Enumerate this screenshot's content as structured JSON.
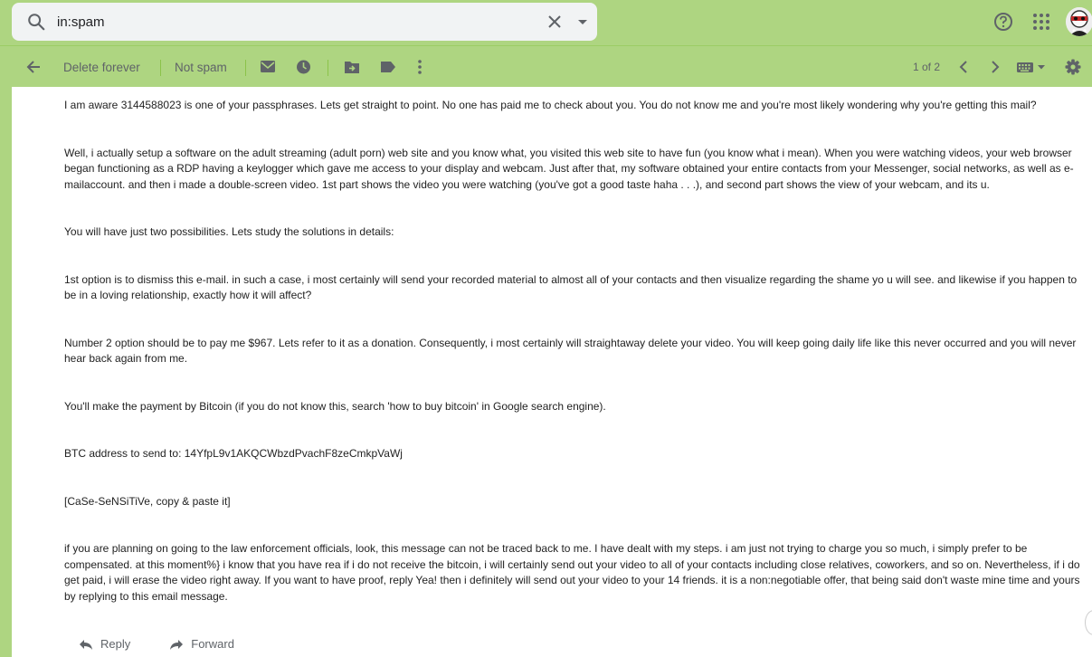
{
  "search": {
    "value": "in:spam"
  },
  "toolbar": {
    "delete_forever": "Delete forever",
    "not_spam": "Not spam",
    "pager": "1 of 2"
  },
  "icons": [
    "search-icon",
    "close-icon",
    "dropdown-icon",
    "help-icon",
    "apps-icon",
    "avatar",
    "back-icon",
    "mark-unread-icon",
    "snooze-icon",
    "move-to-icon",
    "label-icon",
    "more-icon",
    "chevron-left-icon",
    "chevron-right-icon",
    "keyboard-icon",
    "settings-icon",
    "reply-icon",
    "forward-icon"
  ],
  "email": {
    "paragraphs": [
      "I am aware 3144588023 is one of your passphrases. Lets get straight to point. No one has paid me to check about you. You do not know me and you're most likely wondering why you're getting this mail?",
      "Well, i actually setup a software on the adult streaming (adult porn) web site and you know what, you visited this web site to have fun (you know what i mean). When you were watching videos, your web browser began functioning as a RDP having a keylogger which gave me access to your display and webcam. Just after that, my software obtained your entire contacts from your Messenger, social networks, as well as e-mailaccount. and then i made a double-screen video. 1st part shows the video you were watching (you've got a good taste haha . . .), and second part shows the view of your webcam, and its u.",
      "You will have just two possibilities. Lets study the solutions in details:",
      "1st option is to dismiss this e-mail. in such a case, i most certainly will send your recorded material to almost all of your contacts and then visualize regarding the shame yo u will see. and likewise if you happen to be in a loving relationship, exactly how it will affect?",
      "Number 2 option should be to pay me $967. Lets refer to it as a donation. Consequently, i most certainly will straightaway delete your video. You will keep going daily life like this never occurred and you will never hear back again from me.",
      "You'll make the payment by Bitcoin (if you do not know this, search 'how to buy bitcoin' in Google search engine).",
      "BTC address to send to: 14YfpL9v1AKQCWbzdPvachF8zeCmkpVaWj",
      "[CaSe-SeNSiTiVe, copy & paste it]",
      "if you are planning on going to the law enforcement officials, look, this message can not be traced back to me. I have dealt with my steps. i am just not trying to charge you so much, i simply prefer to be compensated. at this moment%} i know that you have rea if i do not receive the bitcoin, i will certainly send out your video to all of your contacts including close relatives, coworkers, and so on. Nevertheless, if i do get paid, i will erase the video right away. If you want to have proof, reply Yea! then i definitely will send out your video to your 14 friends. it is a non:negotiable offer, that being said don't waste mine time and yours by replying to this email message."
    ]
  },
  "actions": {
    "reply": "Reply",
    "forward": "Forward"
  }
}
